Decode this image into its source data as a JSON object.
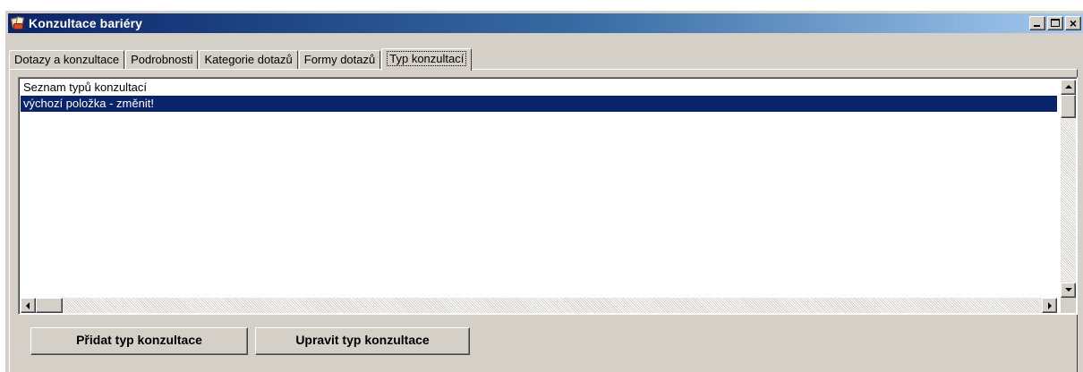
{
  "window": {
    "title": "Konzultace bariéry"
  },
  "tabs": [
    {
      "label": "Dotazy a konzultace",
      "active": false
    },
    {
      "label": "Podrobnosti",
      "active": false
    },
    {
      "label": "Kategorie dotazů",
      "active": false
    },
    {
      "label": "Formy dotazů",
      "active": false
    },
    {
      "label": "Typ konzultací",
      "active": true
    }
  ],
  "list": {
    "header": "Seznam typů konzultací",
    "items": [
      {
        "label": "výchozí položka - změnit!",
        "selected": true
      }
    ]
  },
  "buttons": {
    "add_label": "Přidat typ konzultace",
    "edit_label": "Upravit typ konzultace"
  },
  "colors": {
    "selection": "#0a246a",
    "title_gradient_start": "#0a246a",
    "title_gradient_end": "#a6caf0",
    "face": "#d4d0c8"
  },
  "icons": {
    "app": "documents-app-icon",
    "minimize": "minimize-icon",
    "maximize": "maximize-icon",
    "close": "close-icon"
  }
}
